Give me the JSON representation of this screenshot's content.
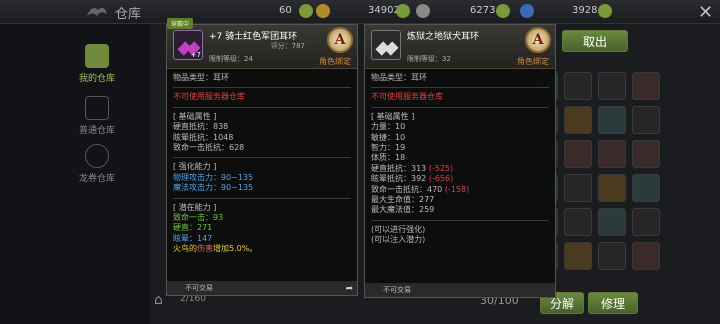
{
  "topbar": {
    "title": "仓库",
    "currencies": [
      {
        "value": "60",
        "icon": "plus-icon"
      },
      {
        "value": "34902",
        "icon": "gold-coin-icon"
      },
      {
        "value": "6273",
        "icon": "silver-coin-icon"
      },
      {
        "value": "3928",
        "icon": "gem-icon"
      }
    ],
    "close_icon": "close-icon"
  },
  "sidebar": {
    "items": [
      {
        "label": "我的仓库",
        "icon": "chest-icon",
        "active": true
      },
      {
        "label": "普通仓库",
        "icon": "building-icon",
        "active": false
      },
      {
        "label": "龙券仓库",
        "icon": "coin-swap-icon",
        "active": false
      }
    ]
  },
  "inventory": {
    "capacity": "30/100",
    "page_count": "2/160",
    "buttons": {
      "take_out": "取出",
      "decompose": "分解",
      "repair": "修理"
    }
  },
  "tooltip_left": {
    "equip_tag": "穿戴中",
    "name": "+7 骑士红色军团耳环",
    "score": "评分：787",
    "level_req": "限制等级：24",
    "grade": "A",
    "bind": "角色绑定",
    "plus_badge": "+7",
    "item_type": "物品类型：耳环",
    "warehouse_warn": "不可使用服务器仓库",
    "base_header": "[ 基础属性 ]",
    "base_stats": [
      "硬直抵抗：838",
      "眩晕抵抗：1048",
      "致命一击抵抗：628"
    ],
    "enh_header": "[ 强化能力 ]",
    "enh_stats": [
      "物理攻击力：90~135",
      "魔法攻击力：90~135"
    ],
    "pot_header": "[ 潜在能力 ]",
    "pot_stats": [
      "致命一击：93",
      "硬直：271",
      "眩晕：147"
    ],
    "pot_special_a": "火鸟的",
    "pot_special_b": "伤害",
    "pot_special_c": "增加5.0%。",
    "footer": "不可交易"
  },
  "tooltip_right": {
    "name": "炼狱之地狱犬耳环",
    "level_req": "限制等级：32",
    "grade": "A",
    "bind": "角色绑定",
    "item_type": "物品类型：耳环",
    "warehouse_warn": "不可使用服务器仓库",
    "base_header": "[ 基础属性 ]",
    "base_stats": [
      {
        "label": "力量：10",
        "diff": ""
      },
      {
        "label": "敏捷：10",
        "diff": ""
      },
      {
        "label": "智力：19",
        "diff": ""
      },
      {
        "label": "体质：18",
        "diff": ""
      },
      {
        "label": "硬直抵抗：313",
        "diff": "(-525)"
      },
      {
        "label": "眩晕抵抗：392",
        "diff": "(-656)"
      },
      {
        "label": "致命一击抵抗：470",
        "diff": "(-158)"
      },
      {
        "label": "最大生命值：277",
        "diff": ""
      },
      {
        "label": "最大魔法值：259",
        "diff": ""
      }
    ],
    "note1": "(可以进行强化)",
    "note2": "(可以注入潜力)",
    "footer": "不可交易"
  },
  "colors": {
    "accent": "#6b8a3e",
    "bind": "#d28a3a",
    "warn": "#e24040",
    "enhance": "#4fa3e8",
    "potential": "#6cc63c"
  }
}
